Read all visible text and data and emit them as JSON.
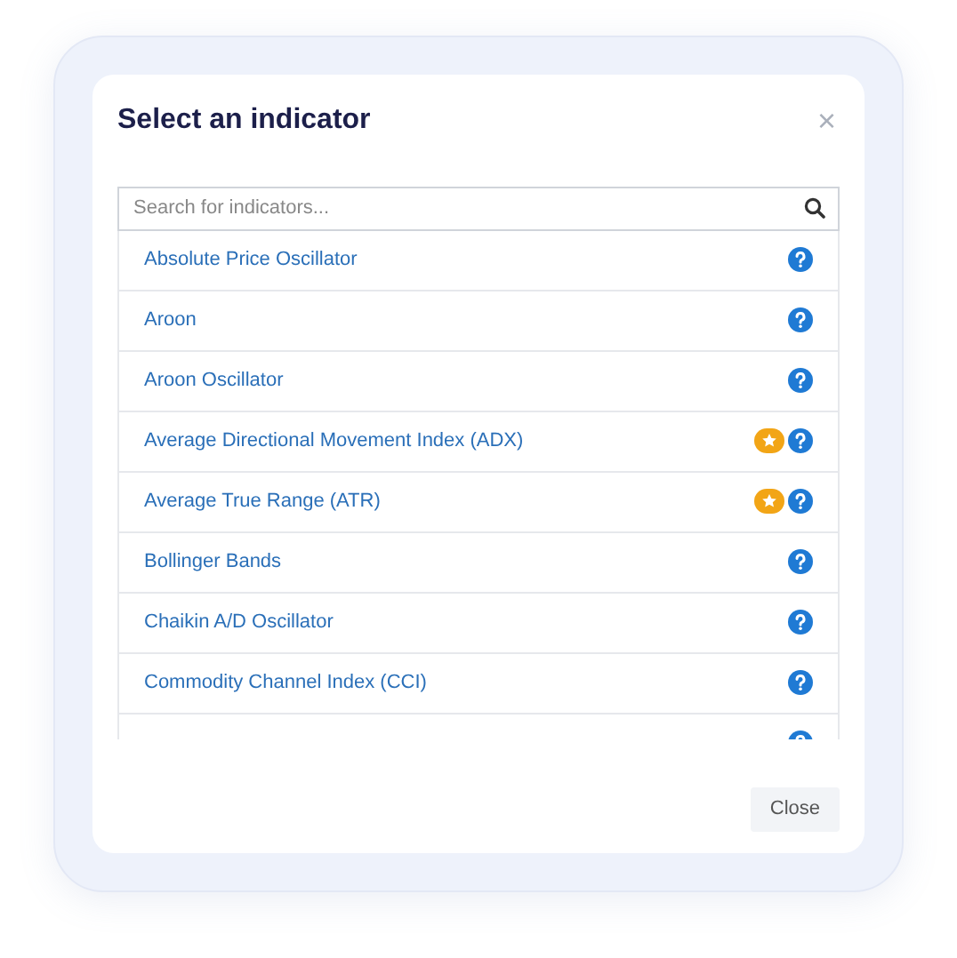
{
  "dialog": {
    "title": "Select an indicator",
    "close_icon": "×"
  },
  "search": {
    "placeholder": "Search for indicators..."
  },
  "indicators": [
    {
      "label": "Absolute Price Oscillator",
      "premium": false
    },
    {
      "label": "Aroon",
      "premium": false
    },
    {
      "label": "Aroon Oscillator",
      "premium": false
    },
    {
      "label": "Average Directional Movement Index (ADX)",
      "premium": true
    },
    {
      "label": "Average True Range (ATR)",
      "premium": true
    },
    {
      "label": "Bollinger Bands",
      "premium": false
    },
    {
      "label": "Chaikin A/D Oscillator",
      "premium": false
    },
    {
      "label": "Commodity Channel Index (CCI)",
      "premium": false
    },
    {
      "premium": false
    }
  ],
  "buttons": [
    {
      "label": "Close"
    }
  ]
}
